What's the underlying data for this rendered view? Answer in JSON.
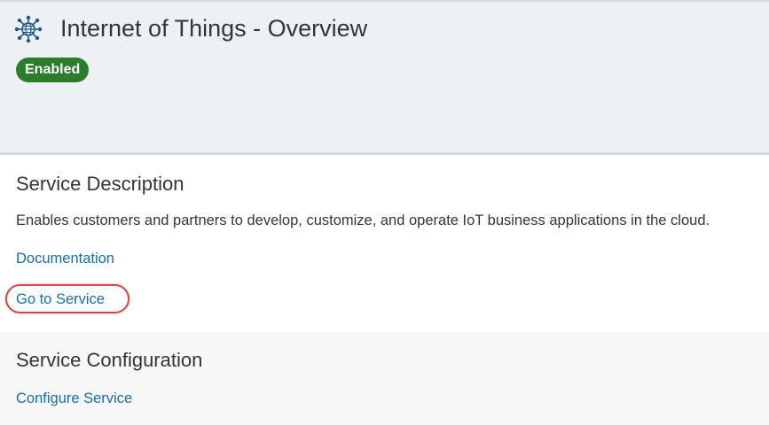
{
  "header": {
    "icon": "iot-network-icon",
    "title": "Internet of Things - Overview",
    "status": "Enabled",
    "status_color": "#2b7d2b"
  },
  "description_section": {
    "heading": "Service Description",
    "text": "Enables customers and partners to develop, customize, and operate IoT business applications in the cloud.",
    "documentation_link": "Documentation",
    "go_to_service_link": "Go to Service"
  },
  "configuration_section": {
    "heading": "Service Configuration",
    "configure_link": "Configure Service"
  },
  "colors": {
    "link": "#1a6fa6",
    "highlight": "#d24a45",
    "header_bg": "#edf1f5"
  }
}
